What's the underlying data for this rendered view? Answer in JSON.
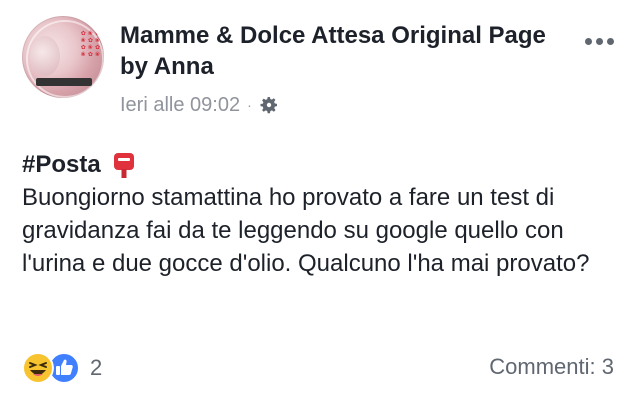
{
  "post": {
    "page_name": "Mamme & Dolce Attesa Original Page by Anna",
    "timestamp": "Ieri alle 09:02",
    "separator": "·",
    "privacy_icon": "gear-icon",
    "hashtag": "#Posta",
    "hashtag_emoji": "postbox-icon",
    "body": "Buongiorno stamattina ho provato a fare un test di gravidanza fai da te leggendo su google quello con l'urina e due gocce d'olio. Qualcuno l'ha mai provato?"
  },
  "reactions": {
    "icons": [
      "haha-reaction-icon",
      "like-reaction-icon"
    ],
    "count": "2"
  },
  "comments_label": "Commenti: 3",
  "colors": {
    "text": "#1d2129",
    "meta": "#90949c",
    "like_blue": "#4080ff",
    "haha_yellow": "#f7c32e",
    "mailbox_red": "#e0323c"
  }
}
